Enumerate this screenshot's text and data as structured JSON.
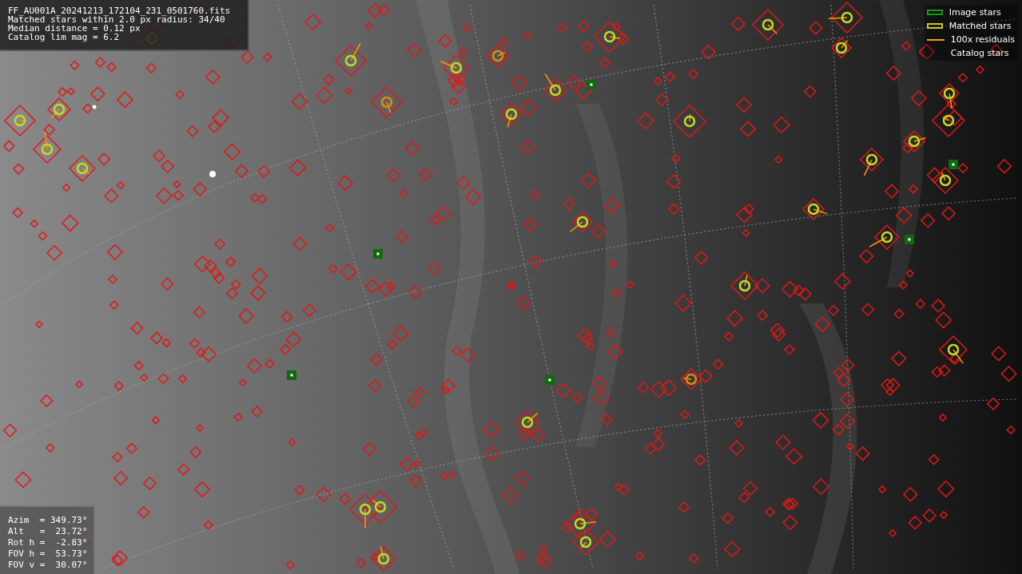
{
  "info_panel": {
    "lines": [
      "FF_AU001A_20241213_172104_231_0501760.fits",
      "Matched stars within 2.0 px radius: 34/40",
      "Median distance = 0.12 px",
      "Catalog lim mag = 6.2"
    ]
  },
  "legend": [
    {
      "kind": "box",
      "label": "Image stars",
      "color": "#1a9a1a"
    },
    {
      "kind": "box",
      "label": "Matched stars",
      "color": "#c8c820"
    },
    {
      "kind": "line",
      "label": "100x residuals",
      "color": "#ff9900"
    },
    {
      "kind": "none",
      "label": "Catalog stars"
    }
  ],
  "pointing_panel": {
    "lines": [
      "Azim  = 349.73°",
      "Alt   =  23.72°",
      "Rot h =  -2.83°",
      "FOV h =  53.73°",
      "FOV v =  30.07°"
    ]
  }
}
